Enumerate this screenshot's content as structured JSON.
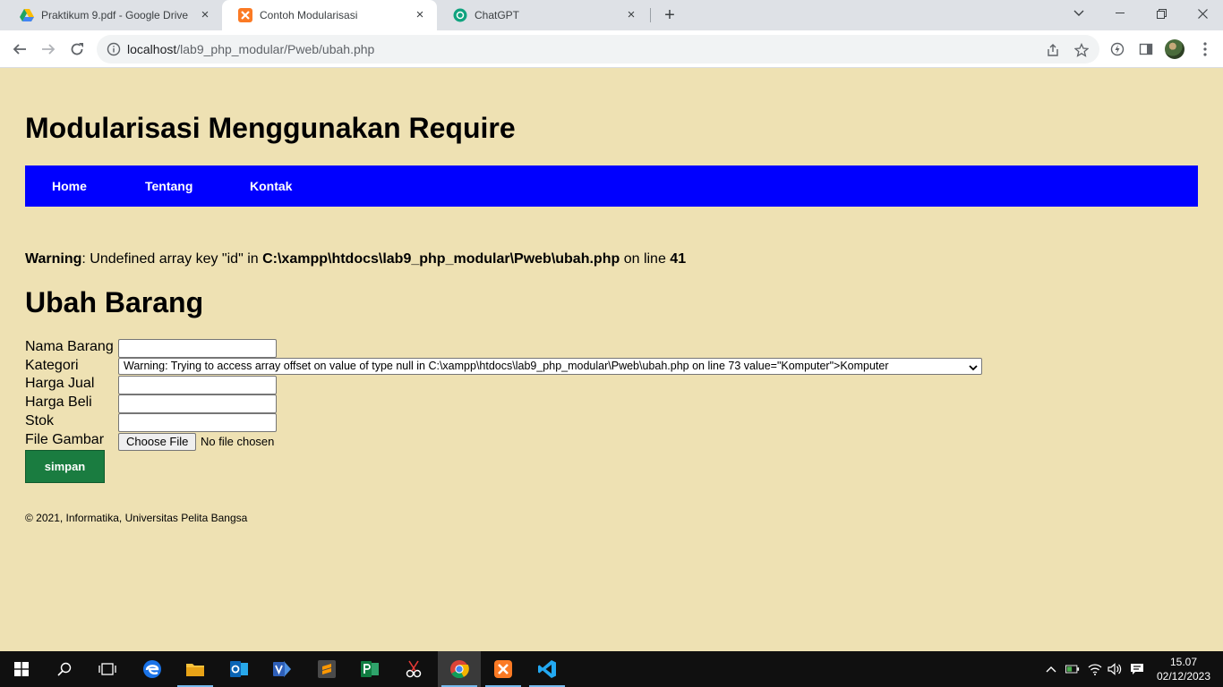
{
  "browser": {
    "tabs": [
      {
        "title": "Praktikum 9.pdf - Google Drive",
        "icon": "google-drive-icon",
        "active": false
      },
      {
        "title": "Contoh Modularisasi",
        "icon": "xampp-icon",
        "active": true
      },
      {
        "title": "ChatGPT",
        "icon": "chatgpt-icon",
        "active": false
      }
    ],
    "url_host": "localhost",
    "url_path": "/lab9_php_modular/Pweb/ubah.php"
  },
  "page": {
    "title": "Modularisasi Menggunakan Require",
    "nav": [
      "Home",
      "Tentang",
      "Kontak"
    ],
    "warning": {
      "label": "Warning",
      "message": ": Undefined array key \"id\" in ",
      "file": "C:\\xampp\\htdocs\\lab9_php_modular\\Pweb\\ubah.php",
      "on_line": " on line ",
      "line": "41"
    },
    "section_title": "Ubah Barang",
    "form": {
      "nama_label": "Nama Barang",
      "kategori_label": "Kategori",
      "kategori_value": "Warning: Trying to access array offset on value of type null in C:\\xampp\\htdocs\\lab9_php_modular\\Pweb\\ubah.php on line 73 value=\"Komputer\">Komputer",
      "harga_jual_label": "Harga Jual",
      "harga_beli_label": "Harga Beli",
      "stok_label": "Stok",
      "gambar_label": "File Gambar",
      "file_button": "Choose File",
      "file_status": "No file chosen",
      "submit": "simpan"
    },
    "footer": "© 2021, Informatika, Universitas Pelita Bangsa"
  },
  "taskbar": {
    "time": "15.07",
    "date": "02/12/2023"
  },
  "colors": {
    "page_bg": "#eee1b3",
    "nav_bg": "#0000ff",
    "submit_bg": "#1a7c40"
  }
}
